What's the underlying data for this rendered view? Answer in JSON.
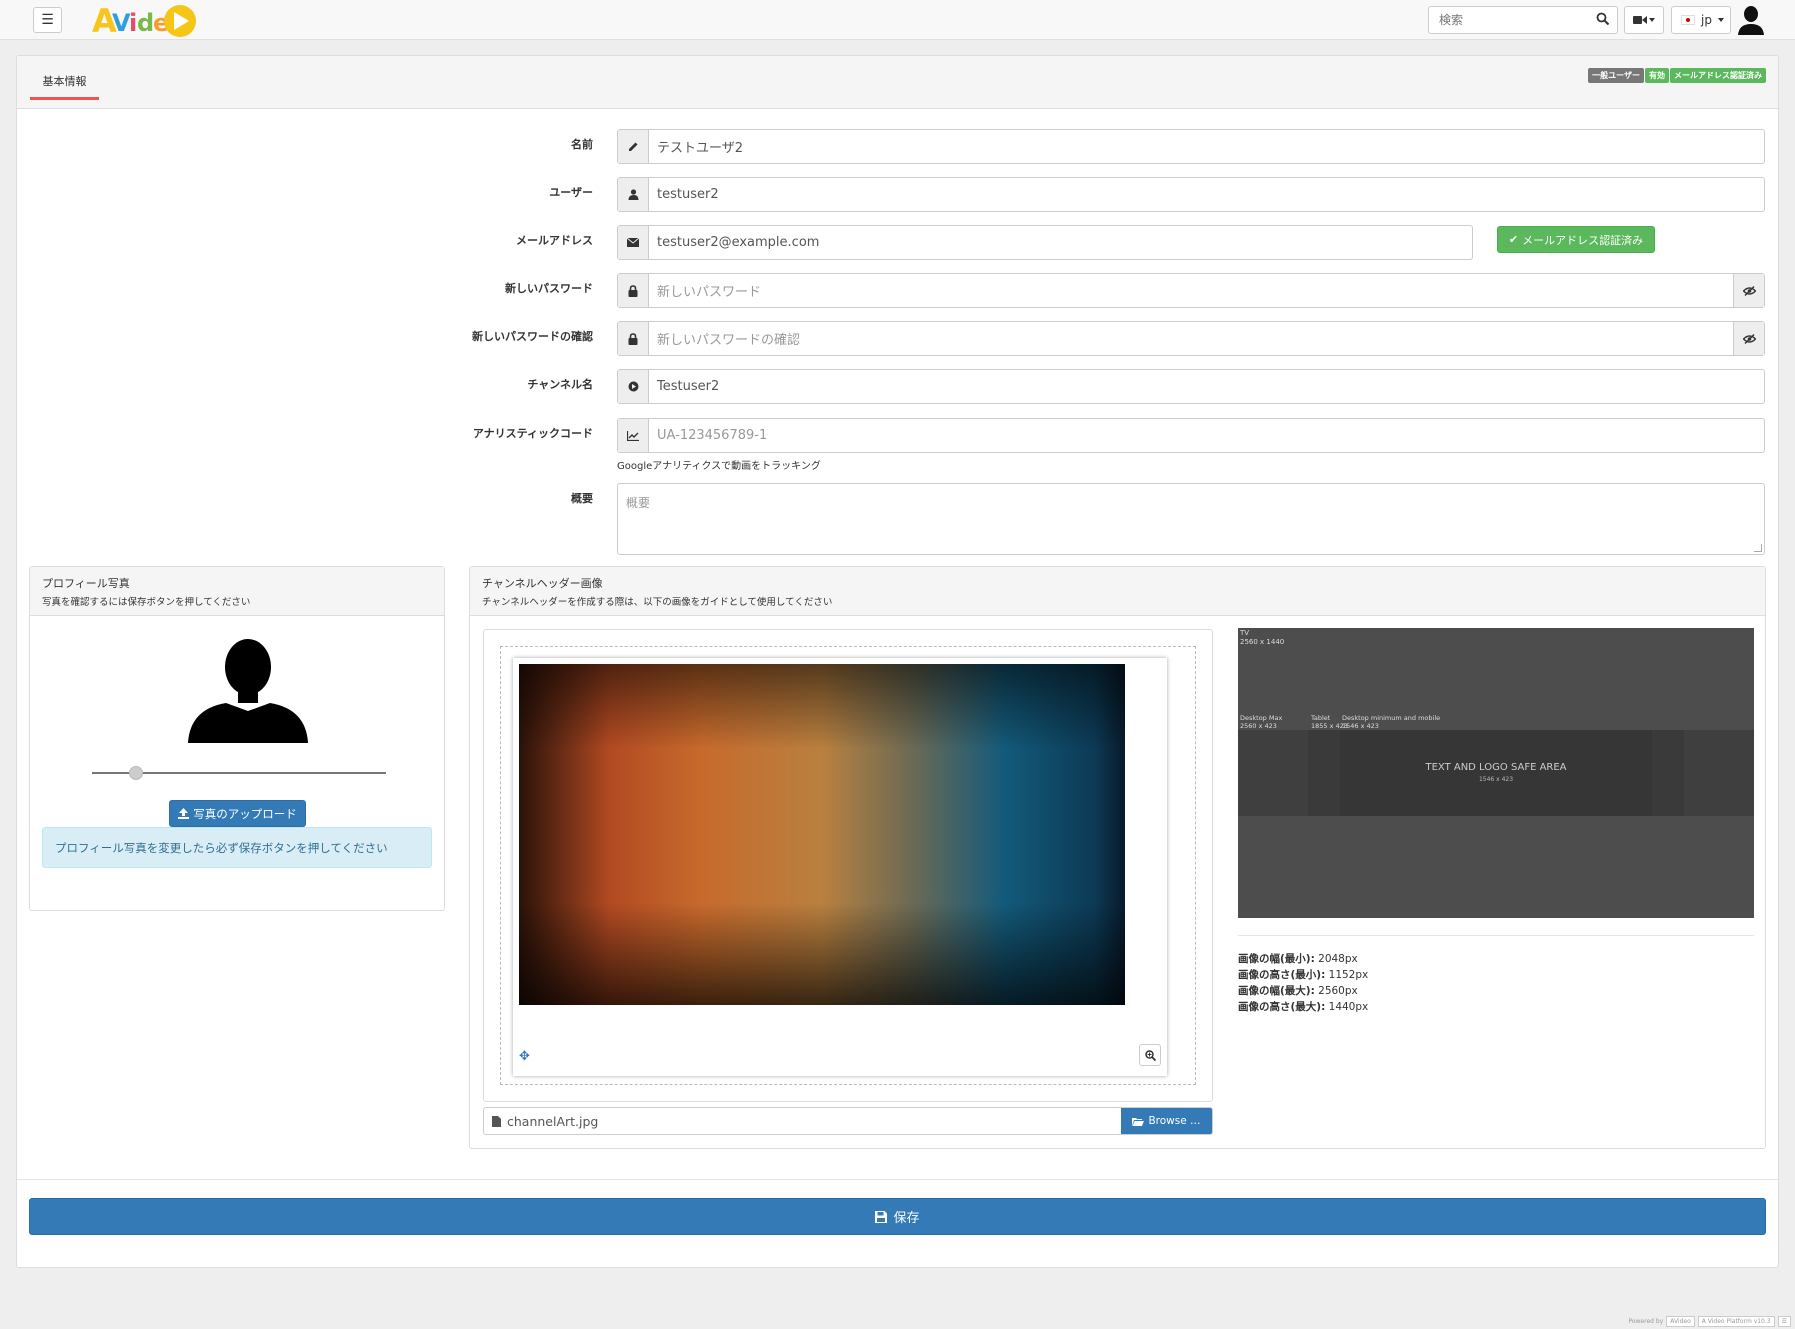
{
  "navbar": {
    "menu_icon": "hamburger-icon",
    "logo_text": "AVideo",
    "search_placeholder": "検索",
    "search_icon": "search-icon",
    "camera_icon": "video-camera-icon",
    "language": "jp",
    "user_icon": "user-silhouette-icon"
  },
  "tabs": [
    {
      "label": "基本情報",
      "active": true
    }
  ],
  "badges": [
    {
      "label": "一般ユーザー",
      "color": "#777777"
    },
    {
      "label": "有効",
      "color": "#5cb85c"
    },
    {
      "label": "メールアドレス認証済み",
      "color": "#5cb85c"
    }
  ],
  "form": {
    "name": {
      "label": "名前",
      "value": "テストユーザ2",
      "icon": "pencil-icon"
    },
    "user": {
      "label": "ユーザー",
      "value": "testuser2",
      "icon": "user-icon"
    },
    "email": {
      "label": "メールアドレス",
      "value": "testuser2@example.com",
      "icon": "envelope-icon",
      "verified_label": "メールアドレス認証済み"
    },
    "new_password": {
      "label": "新しいパスワード",
      "placeholder": "新しいパスワード",
      "icon": "lock-icon",
      "toggle_icon": "eye-slash-icon"
    },
    "confirm_password": {
      "label": "新しいパスワードの確認",
      "placeholder": "新しいパスワードの確認",
      "icon": "lock-icon",
      "toggle_icon": "eye-slash-icon"
    },
    "channel_name": {
      "label": "チャンネル名",
      "value": "Testuser2",
      "icon": "play-circle-icon"
    },
    "analytics": {
      "label": "アナリスティックコード",
      "placeholder": "UA-123456789-1",
      "icon": "chart-icon",
      "help": "Googleアナリティクスで動画をトラッキング"
    },
    "about": {
      "label": "概要",
      "placeholder": "概要"
    }
  },
  "profile_photo": {
    "title": "プロフィール写真",
    "subtitle": "写真を確認するには保存ボタンを押してください",
    "zoom_level": 0.15,
    "upload_label": "写真のアップロード",
    "notice": "プロフィール写真を変更したら必ず保存ボタンを押してください"
  },
  "channel_header": {
    "title": "チャンネルヘッダー画像",
    "subtitle": "チャンネルヘッダーを作成する際は、以下の画像をガイドとして使用してください",
    "file_name": "channelArt.jpg",
    "browse_label": "Browse …",
    "guide": {
      "tv_label": "TV",
      "tv_size": "2560 x 1440",
      "desktop_max_label": "Desktop Max",
      "desktop_max_size": "2560 x 423",
      "tablet_label": "Tablet",
      "tablet_size": "1855 x 423",
      "desktop_min_label": "Desktop minimum and mobile",
      "desktop_min_size": "1546 x 423",
      "safe_area": "TEXT AND LOGO SAFE AREA",
      "safe_size": "1546 x 423"
    },
    "specs": [
      {
        "label": "画像の幅(最小):",
        "value": "2048px"
      },
      {
        "label": "画像の高さ(最小):",
        "value": "1152px"
      },
      {
        "label": "画像の幅(最大):",
        "value": "2560px"
      },
      {
        "label": "画像の高さ(最大):",
        "value": "1440px"
      }
    ]
  },
  "save_label": "保存",
  "footer": {
    "powered_by": "Powered by",
    "brand": "AVideo",
    "version": "A Video Platform v10.3"
  }
}
